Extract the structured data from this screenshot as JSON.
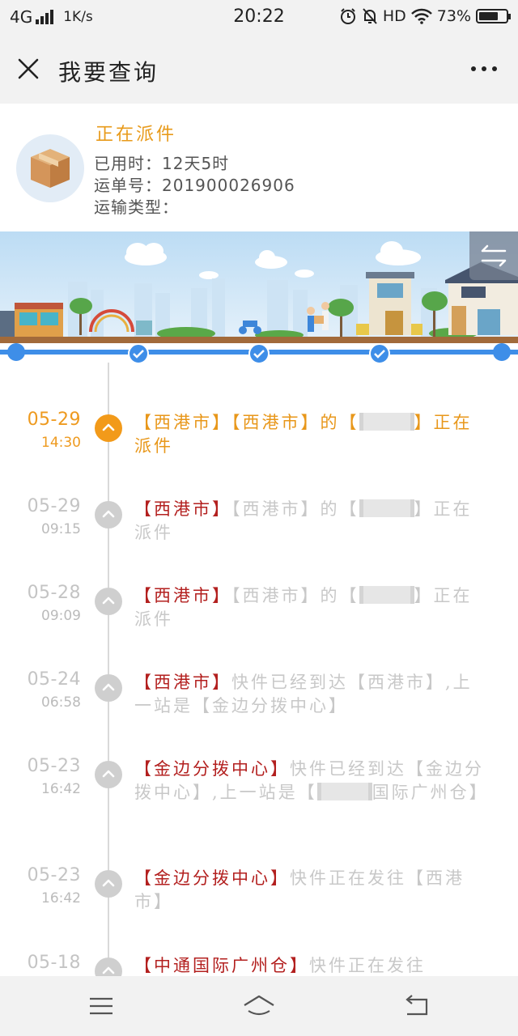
{
  "status_bar": {
    "network": "4G",
    "speed": "1K/s",
    "time": "20:22",
    "hd": "HD",
    "battery_text": "73%",
    "battery_level": 0.73
  },
  "nav": {
    "title": "我要查询"
  },
  "summary": {
    "status": "正在派件",
    "elapsed_label": "已用时：",
    "elapsed_value": "12天5时",
    "waybill_label": "运单号：",
    "waybill_value": "201900026906",
    "transport_label": "运输类型："
  },
  "events": [
    {
      "date": "05-29",
      "time": "14:30",
      "active": true,
      "segments": [
        {
          "t": "【西港市】【西港市】的【",
          "hl": false
        },
        {
          "redact": true
        },
        {
          "t": "】正在派件",
          "hl": false
        }
      ]
    },
    {
      "date": "05-29",
      "time": "09:15",
      "active": false,
      "segments": [
        {
          "t": "【西港市】",
          "hl": true
        },
        {
          "t": "【西港市】的【",
          "hl": false
        },
        {
          "redact": true
        },
        {
          "t": "】正在派件",
          "hl": false
        }
      ]
    },
    {
      "date": "05-28",
      "time": "09:09",
      "active": false,
      "segments": [
        {
          "t": "【西港市】",
          "hl": true
        },
        {
          "t": "【西港市】的【",
          "hl": false
        },
        {
          "redact": true
        },
        {
          "t": "】正在派件",
          "hl": false
        }
      ]
    },
    {
      "date": "05-24",
      "time": "06:58",
      "active": false,
      "segments": [
        {
          "t": "【西港市】",
          "hl": true
        },
        {
          "t": "快件已经到达【西港市】,上一站是【金边分拨中心】",
          "hl": false
        }
      ]
    },
    {
      "date": "05-23",
      "time": "16:42",
      "active": false,
      "segments": [
        {
          "t": "【金边分拨中心】",
          "hl": true
        },
        {
          "t": "快件已经到达【金边分拨中心】,上一站是【",
          "hl": false
        },
        {
          "redact": true
        },
        {
          "t": "国际广州仓】",
          "hl": false
        }
      ]
    },
    {
      "date": "05-23",
      "time": "16:42",
      "active": false,
      "segments": [
        {
          "t": "【金边分拨中心】",
          "hl": true
        },
        {
          "t": "快件正在发往【西港市】",
          "hl": false
        }
      ]
    },
    {
      "date": "05-18",
      "time": "",
      "active": false,
      "segments": [
        {
          "t": "【中通国际广州仓】",
          "hl": true
        },
        {
          "t": "快件正在发往",
          "hl": false
        }
      ]
    }
  ],
  "colors": {
    "accent_orange": "#e8971a",
    "highlight_red": "#b3201f",
    "progress_blue": "#3e8ee8"
  }
}
